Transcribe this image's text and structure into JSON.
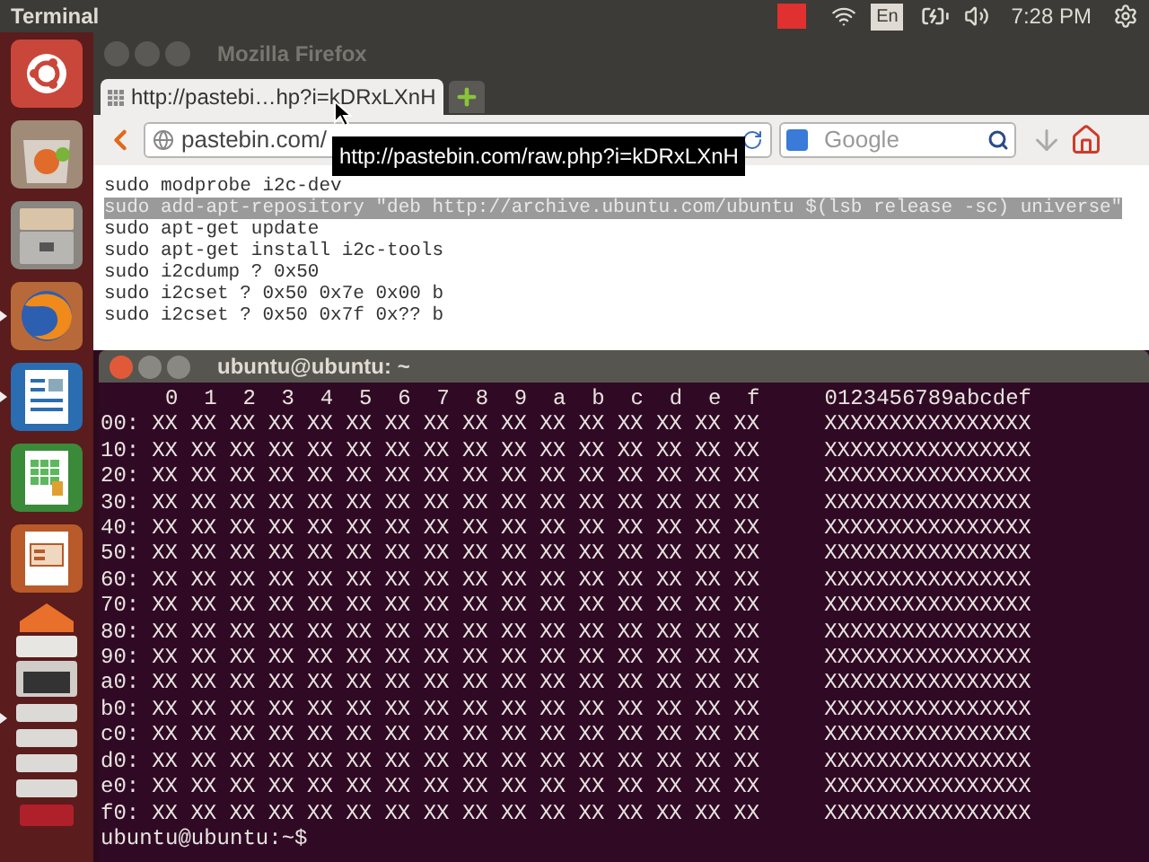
{
  "top_panel": {
    "app_title": "Terminal",
    "keyboard": "En",
    "clock": "7:28 PM"
  },
  "launcher": {
    "items": [
      {
        "kind": "dash",
        "running": false
      },
      {
        "kind": "software",
        "running": false
      },
      {
        "kind": "files",
        "running": false
      },
      {
        "kind": "browser",
        "running": true
      },
      {
        "kind": "writer",
        "running": true
      },
      {
        "kind": "calc",
        "running": false
      },
      {
        "kind": "impress",
        "running": false
      },
      {
        "kind": "stack",
        "running": true
      }
    ]
  },
  "browser": {
    "title": "Mozilla Firefox",
    "tab": "http://pastebi…hp?i=kDRxLXnH",
    "url": "pastebin.com/",
    "search_placeholder": "Google",
    "tooltip": "http://pastebin.com/raw.php?i=kDRxLXnH",
    "lines": [
      {
        "text": "sudo modprobe i2c-dev",
        "selected": false
      },
      {
        "text": "sudo add-apt-repository \"deb http://archive.ubuntu.com/ubuntu $(lsb release -sc) universe\"",
        "selected": true
      },
      {
        "text": "sudo apt-get update",
        "selected": false
      },
      {
        "text": "sudo apt-get install i2c-tools",
        "selected": false
      },
      {
        "text": "sudo i2cdump ? 0x50",
        "selected": false
      },
      {
        "text": "sudo i2cset ? 0x50 0x7e 0x00 b",
        "selected": false
      },
      {
        "text": "sudo i2cset ? 0x50 0x7f 0x?? b",
        "selected": false
      }
    ]
  },
  "terminal": {
    "title": "ubuntu@ubuntu: ~",
    "header": {
      "hex": "0  1  2  3  4  5  6  7  8  9  a  b  c  d  e  f",
      "ascii": "0123456789abcdef"
    },
    "rows": [
      {
        "address": "00:",
        "bytes": "XX XX XX XX XX XX XX XX XX XX XX XX XX XX XX XX",
        "ascii": "XXXXXXXXXXXXXXXX"
      },
      {
        "address": "10:",
        "bytes": "XX XX XX XX XX XX XX XX XX XX XX XX XX XX XX XX",
        "ascii": "XXXXXXXXXXXXXXXX"
      },
      {
        "address": "20:",
        "bytes": "XX XX XX XX XX XX XX XX XX XX XX XX XX XX XX XX",
        "ascii": "XXXXXXXXXXXXXXXX"
      },
      {
        "address": "30:",
        "bytes": "XX XX XX XX XX XX XX XX XX XX XX XX XX XX XX XX",
        "ascii": "XXXXXXXXXXXXXXXX"
      },
      {
        "address": "40:",
        "bytes": "XX XX XX XX XX XX XX XX XX XX XX XX XX XX XX XX",
        "ascii": "XXXXXXXXXXXXXXXX"
      },
      {
        "address": "50:",
        "bytes": "XX XX XX XX XX XX XX XX XX XX XX XX XX XX XX XX",
        "ascii": "XXXXXXXXXXXXXXXX"
      },
      {
        "address": "60:",
        "bytes": "XX XX XX XX XX XX XX XX XX XX XX XX XX XX XX XX",
        "ascii": "XXXXXXXXXXXXXXXX"
      },
      {
        "address": "70:",
        "bytes": "XX XX XX XX XX XX XX XX XX XX XX XX XX XX XX XX",
        "ascii": "XXXXXXXXXXXXXXXX"
      },
      {
        "address": "80:",
        "bytes": "XX XX XX XX XX XX XX XX XX XX XX XX XX XX XX XX",
        "ascii": "XXXXXXXXXXXXXXXX"
      },
      {
        "address": "90:",
        "bytes": "XX XX XX XX XX XX XX XX XX XX XX XX XX XX XX XX",
        "ascii": "XXXXXXXXXXXXXXXX"
      },
      {
        "address": "a0:",
        "bytes": "XX XX XX XX XX XX XX XX XX XX XX XX XX XX XX XX",
        "ascii": "XXXXXXXXXXXXXXXX"
      },
      {
        "address": "b0:",
        "bytes": "XX XX XX XX XX XX XX XX XX XX XX XX XX XX XX XX",
        "ascii": "XXXXXXXXXXXXXXXX"
      },
      {
        "address": "c0:",
        "bytes": "XX XX XX XX XX XX XX XX XX XX XX XX XX XX XX XX",
        "ascii": "XXXXXXXXXXXXXXXX"
      },
      {
        "address": "d0:",
        "bytes": "XX XX XX XX XX XX XX XX XX XX XX XX XX XX XX XX",
        "ascii": "XXXXXXXXXXXXXXXX"
      },
      {
        "address": "e0:",
        "bytes": "XX XX XX XX XX XX XX XX XX XX XX XX XX XX XX XX",
        "ascii": "XXXXXXXXXXXXXXXX"
      },
      {
        "address": "f0:",
        "bytes": "XX XX XX XX XX XX XX XX XX XX XX XX XX XX XX XX",
        "ascii": "XXXXXXXXXXXXXXXX"
      }
    ],
    "prompt": "ubuntu@ubuntu:~$"
  }
}
